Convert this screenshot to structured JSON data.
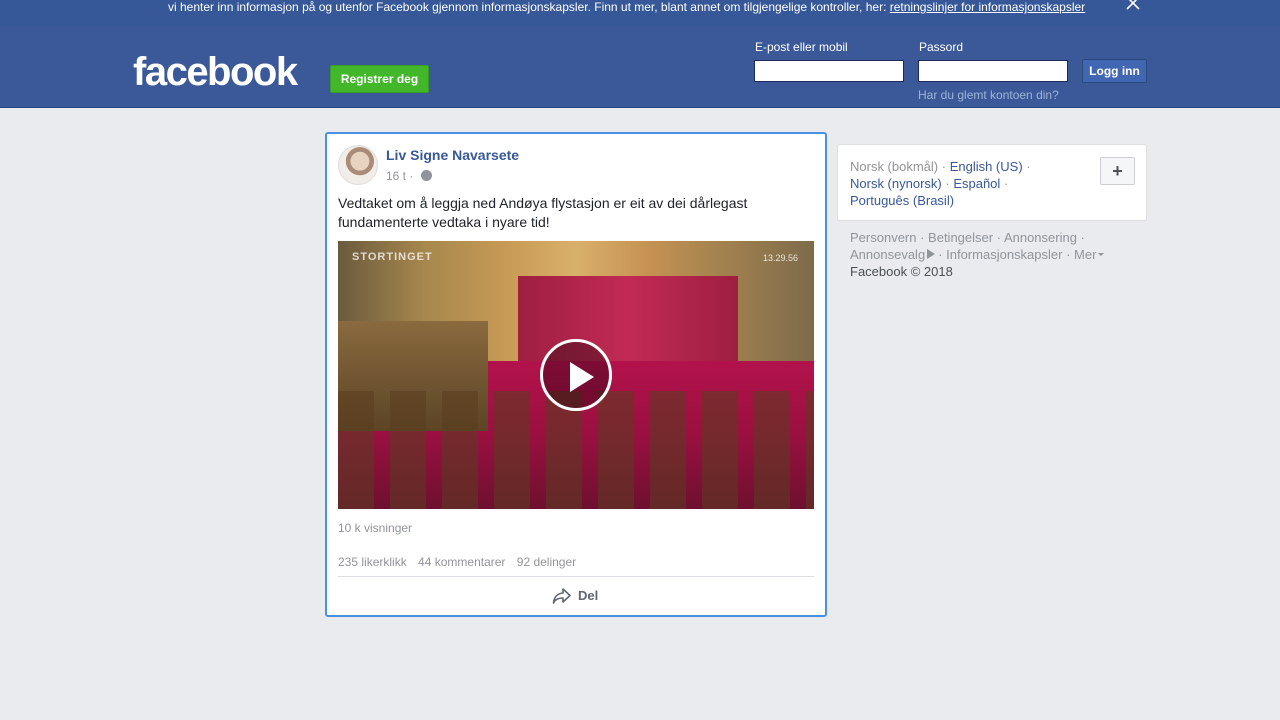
{
  "cookie_banner": {
    "text": "vi henter inn informasjon på og utenfor Facebook gjennom informasjonskapsler. Finn ut mer, blant annet om tilgjengelige kontroller, her: ",
    "link": "retningslinjer for informasjonskapsler",
    "close_icon": "close-icon"
  },
  "header": {
    "logo": "facebook",
    "signup_label": "Registrer deg",
    "email_label": "E-post eller mobil",
    "password_label": "Passord",
    "login_label": "Logg inn",
    "forgot_link": "Har du glemt kontoen din?",
    "colors": {
      "bar": "#3b5998",
      "signup": "#42b72a",
      "login": "#4267b2"
    }
  },
  "post": {
    "author": "Liv Signe Navarsete",
    "time": "16 t",
    "separator": "·",
    "privacy_icon": "globe-icon",
    "text": "Vedtaket om å leggja ned Andøya flystasjon er eit av dei dårlegast fundamenterte vedtaka i nyare tid!",
    "video": {
      "watermark": "STORTINGET",
      "timestamp": "13.29.56",
      "play_icon": "play-icon"
    },
    "views": "10 k visninger",
    "stats": {
      "likes": "235 likerklikk",
      "comments": "44 kommentarer",
      "shares": "92 delinger"
    },
    "share_label": "Del",
    "share_icon": "share-icon"
  },
  "languages": {
    "current": "Norsk (bokmål)",
    "options": [
      "English (US)",
      "Norsk (nynorsk)",
      "Español",
      "Português (Brasil)"
    ],
    "add_icon": "plus-icon"
  },
  "footer": {
    "links": [
      "Personvern",
      "Betingelser",
      "Annonsering",
      "Annonsevalg",
      "Informasjonskapsler",
      "Mer"
    ],
    "copyright": "Facebook © 2018"
  }
}
